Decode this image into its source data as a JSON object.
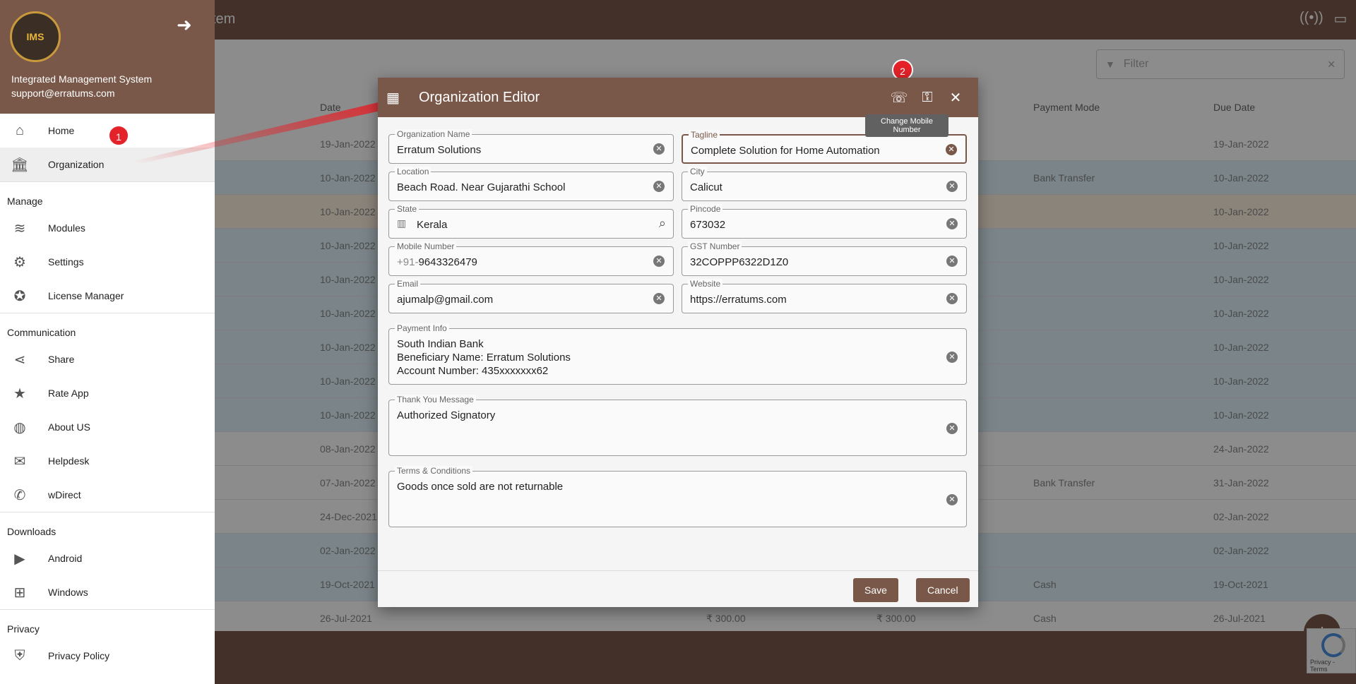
{
  "app": {
    "title": "ystem",
    "logo_text": "IMS"
  },
  "filter": {
    "placeholder": "Filter"
  },
  "table": {
    "headers": {
      "date": "Date",
      "payment_mode": "Payment Mode",
      "due_date": "Due Date"
    },
    "rows": [
      {
        "date": "19-Jan-2022",
        "amount": "",
        "paid": "",
        "mode": "",
        "due": "19-Jan-2022",
        "style": "white"
      },
      {
        "date": "10-Jan-2022",
        "amount": "",
        "paid": "",
        "mode": "Bank Transfer",
        "due": "10-Jan-2022",
        "style": "blue"
      },
      {
        "date": "10-Jan-2022",
        "amount": "",
        "paid": "",
        "mode": "",
        "due": "10-Jan-2022",
        "style": "orange"
      },
      {
        "date": "10-Jan-2022",
        "amount": "",
        "paid": "",
        "mode": "",
        "due": "10-Jan-2022",
        "style": "blue"
      },
      {
        "date": "10-Jan-2022",
        "amount": "",
        "paid": "",
        "mode": "",
        "due": "10-Jan-2022",
        "style": "blue"
      },
      {
        "date": "10-Jan-2022",
        "amount": "",
        "paid": "",
        "mode": "",
        "due": "10-Jan-2022",
        "style": "blue"
      },
      {
        "date": "10-Jan-2022",
        "amount": "",
        "paid": "",
        "mode": "",
        "due": "10-Jan-2022",
        "style": "blue"
      },
      {
        "date": "10-Jan-2022",
        "amount": "",
        "paid": "",
        "mode": "",
        "due": "10-Jan-2022",
        "style": "blue"
      },
      {
        "date": "10-Jan-2022",
        "amount": "",
        "paid": "",
        "mode": "",
        "due": "10-Jan-2022",
        "style": "blue"
      },
      {
        "date": "08-Jan-2022",
        "amount": "",
        "paid": "",
        "mode": "",
        "due": "24-Jan-2022",
        "style": "white"
      },
      {
        "date": "07-Jan-2022",
        "amount": "",
        "paid": "",
        "mode": "Bank Transfer",
        "due": "31-Jan-2022",
        "style": "white"
      },
      {
        "date": "24-Dec-2021",
        "amount": "",
        "paid": "",
        "mode": "",
        "due": "02-Jan-2022",
        "style": "white"
      },
      {
        "date": "02-Jan-2022",
        "amount": "",
        "paid": "",
        "mode": "",
        "due": "02-Jan-2022",
        "style": "blue"
      },
      {
        "date": "19-Oct-2021",
        "amount": "",
        "paid": "",
        "mode": "Cash",
        "due": "19-Oct-2021",
        "style": "blue"
      },
      {
        "date": "26-Jul-2021",
        "amount": "₹ 300.00",
        "paid": "₹ 300.00",
        "mode": "Cash",
        "due": "26-Jul-2021",
        "style": "white"
      }
    ]
  },
  "sidebar": {
    "org_name": "Integrated Management System",
    "email": "support@erratums.com",
    "items": [
      {
        "label": "Home",
        "icon": "home-icon"
      },
      {
        "label": "Organization",
        "icon": "bank-icon"
      }
    ],
    "sections": [
      {
        "title": "Manage",
        "items": [
          {
            "label": "Modules",
            "icon": "layers-icon"
          },
          {
            "label": "Settings",
            "icon": "gears-icon"
          },
          {
            "label": "License Manager",
            "icon": "award-icon"
          }
        ]
      },
      {
        "title": "Communication",
        "items": [
          {
            "label": "Share",
            "icon": "share-icon"
          },
          {
            "label": "Rate App",
            "icon": "star-icon"
          },
          {
            "label": "About US",
            "icon": "globe-icon"
          },
          {
            "label": "Helpdesk",
            "icon": "chat-icon"
          },
          {
            "label": "wDirect",
            "icon": "whatsapp-icon"
          }
        ]
      },
      {
        "title": "Downloads",
        "items": [
          {
            "label": "Android",
            "icon": "play-store-icon"
          },
          {
            "label": "Windows",
            "icon": "windows-icon"
          }
        ]
      },
      {
        "title": "Privacy",
        "items": [
          {
            "label": "Privacy Policy",
            "icon": "shield-icon"
          }
        ]
      }
    ]
  },
  "badges": {
    "one": "1",
    "two": "2"
  },
  "dialog": {
    "title": "Organization Editor",
    "tooltip": "Change Mobile Number",
    "fields": {
      "org_name": {
        "label": "Organization Name",
        "value": "Erratum Solutions"
      },
      "tagline": {
        "label": "Tagline",
        "value": "Complete Solution for Home Automation"
      },
      "location": {
        "label": "Location",
        "value": "Beach Road. Near Gujarathi School"
      },
      "city": {
        "label": "City",
        "value": "Calicut"
      },
      "state": {
        "label": "State",
        "value": "Kerala"
      },
      "pincode": {
        "label": "Pincode",
        "value": "673032"
      },
      "mobile": {
        "label": "Mobile Number",
        "prefix": "+91-",
        "value": "9643326479"
      },
      "gst": {
        "label": "GST Number",
        "value": "32COPPP6322D1Z0"
      },
      "email": {
        "label": "Email",
        "value": "ajumalp@gmail.com"
      },
      "website": {
        "label": "Website",
        "value": "https://erratums.com"
      },
      "payment_info": {
        "label": "Payment Info",
        "value": "South Indian Bank\nBeneficiary Name: Erratum Solutions\nAccount Number: 435xxxxxxx62"
      },
      "thank_you": {
        "label": "Thank You Message",
        "value": "Authorized Signatory"
      },
      "terms": {
        "label": "Terms & Conditions",
        "value": "Goods once sold are not returnable"
      }
    },
    "save_label": "Save",
    "cancel_label": "Cancel"
  },
  "recaptcha": {
    "text": "Privacy - Terms"
  },
  "colors": {
    "primary": "#7a5849",
    "row_blue": "#dff1fa",
    "row_orange": "#fdf1e1",
    "badge": "#e42229"
  }
}
